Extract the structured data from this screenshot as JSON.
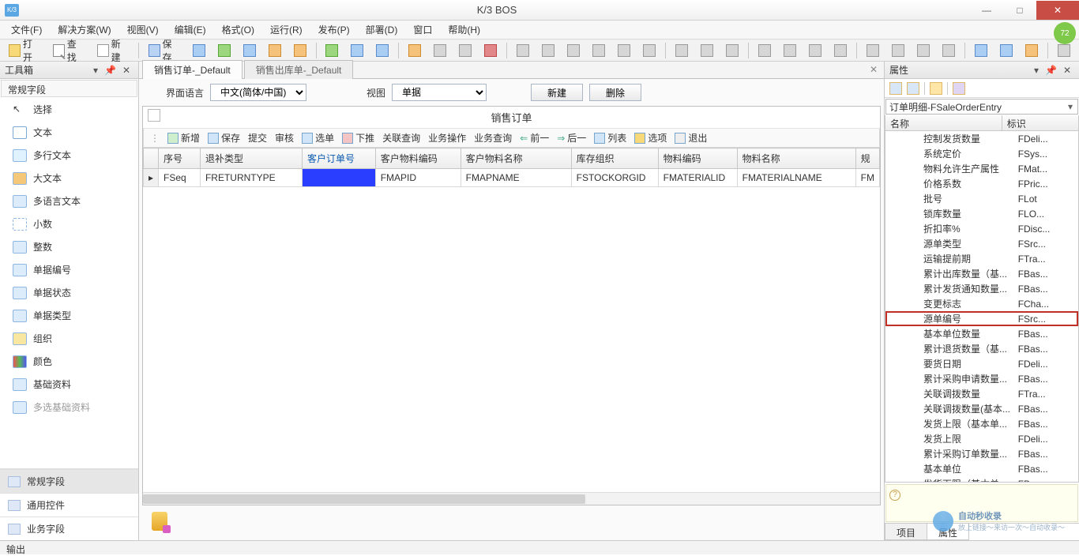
{
  "titlebar": {
    "app_icon_label": "K/3",
    "title": "K/3 BOS",
    "badge": "72"
  },
  "menubar": {
    "items": [
      "文件(F)",
      "解决方案(W)",
      "视图(V)",
      "编辑(E)",
      "格式(O)",
      "运行(R)",
      "发布(P)",
      "部署(D)",
      "窗口",
      "帮助(H)"
    ]
  },
  "main_toolbar": {
    "buttons_text": [
      "打开",
      "查找",
      "新建",
      "保存"
    ]
  },
  "left_panel": {
    "title": "工具箱",
    "section": "常规字段",
    "items": [
      "选择",
      "文本",
      "多行文本",
      "大文本",
      "多语言文本",
      "小数",
      "整数",
      "单据编号",
      "单据状态",
      "单据类型",
      "组织",
      "颜色",
      "基础资料",
      "多选基础资料"
    ],
    "categories": [
      "常规字段",
      "通用控件",
      "业务字段"
    ]
  },
  "center": {
    "tabs": [
      "销售订单-_Default",
      "销售出库单-_Default"
    ],
    "lang_label": "界面语言",
    "lang_options": [
      "中文(简体/中国)"
    ],
    "view_label": "视图",
    "view_options": [
      "单据"
    ],
    "btn_new": "新建",
    "btn_del": "删除",
    "order_title": "销售订单",
    "sub_buttons": [
      "新增",
      "保存",
      "提交",
      "审核",
      "选单",
      "下推",
      "关联查询",
      "业务操作",
      "业务查询",
      "前一",
      "后一",
      "列表",
      "选项",
      "退出"
    ],
    "columns": [
      "序号",
      "退补类型",
      "客户订单号",
      "客户物料编码",
      "客户物料名称",
      "库存组织",
      "物料编码",
      "物料名称",
      "规"
    ],
    "row": [
      "FSeq",
      "FRETURNTYPE",
      "",
      "FMAPID",
      "FMAPNAME",
      "FSTOCKORGID",
      "FMATERIALID",
      "FMATERIALNAME",
      "FM"
    ]
  },
  "right_panel": {
    "title": "属性",
    "object": "订单明细-FSaleOrderEntry",
    "header": [
      "名称",
      "标识"
    ],
    "rows": [
      {
        "n": "控制发货数量",
        "v": "FDeli..."
      },
      {
        "n": "系统定价",
        "v": "FSys..."
      },
      {
        "n": "物料允许生产属性",
        "v": "FMat..."
      },
      {
        "n": "价格系数",
        "v": "FPric..."
      },
      {
        "n": "批号",
        "v": "FLot"
      },
      {
        "n": "锁库数量",
        "v": "FLO..."
      },
      {
        "n": "折扣率%",
        "v": "FDisc..."
      },
      {
        "n": "源单类型",
        "v": "FSrc..."
      },
      {
        "n": "运输提前期",
        "v": "FTra..."
      },
      {
        "n": "累计出库数量（基...",
        "v": "FBas..."
      },
      {
        "n": "累计发货通知数量...",
        "v": "FBas..."
      },
      {
        "n": "变更标志",
        "v": "FCha..."
      },
      {
        "n": "源单编号",
        "v": "FSrc...",
        "hl": true
      },
      {
        "n": "基本单位数量",
        "v": "FBas..."
      },
      {
        "n": "累计退货数量（基...",
        "v": "FBas..."
      },
      {
        "n": "要货日期",
        "v": "FDeli..."
      },
      {
        "n": "累计采购申请数量...",
        "v": "FBas..."
      },
      {
        "n": "关联调拨数量",
        "v": "FTra..."
      },
      {
        "n": "关联调拨数量(基本...",
        "v": "FBas..."
      },
      {
        "n": "发货上限（基本单...",
        "v": "FBas..."
      },
      {
        "n": "发货上限",
        "v": "FDeli..."
      },
      {
        "n": "累计采购订单数量...",
        "v": "FBas..."
      },
      {
        "n": "基本单位",
        "v": "FBas..."
      },
      {
        "n": "发货下限（基本单",
        "v": "FBas"
      }
    ],
    "tabs": [
      "项目",
      "属性"
    ]
  },
  "output_label": "输出",
  "watermark": {
    "name": "自动秒收录",
    "sub": "放上链接～来访一次～自动收录～"
  }
}
